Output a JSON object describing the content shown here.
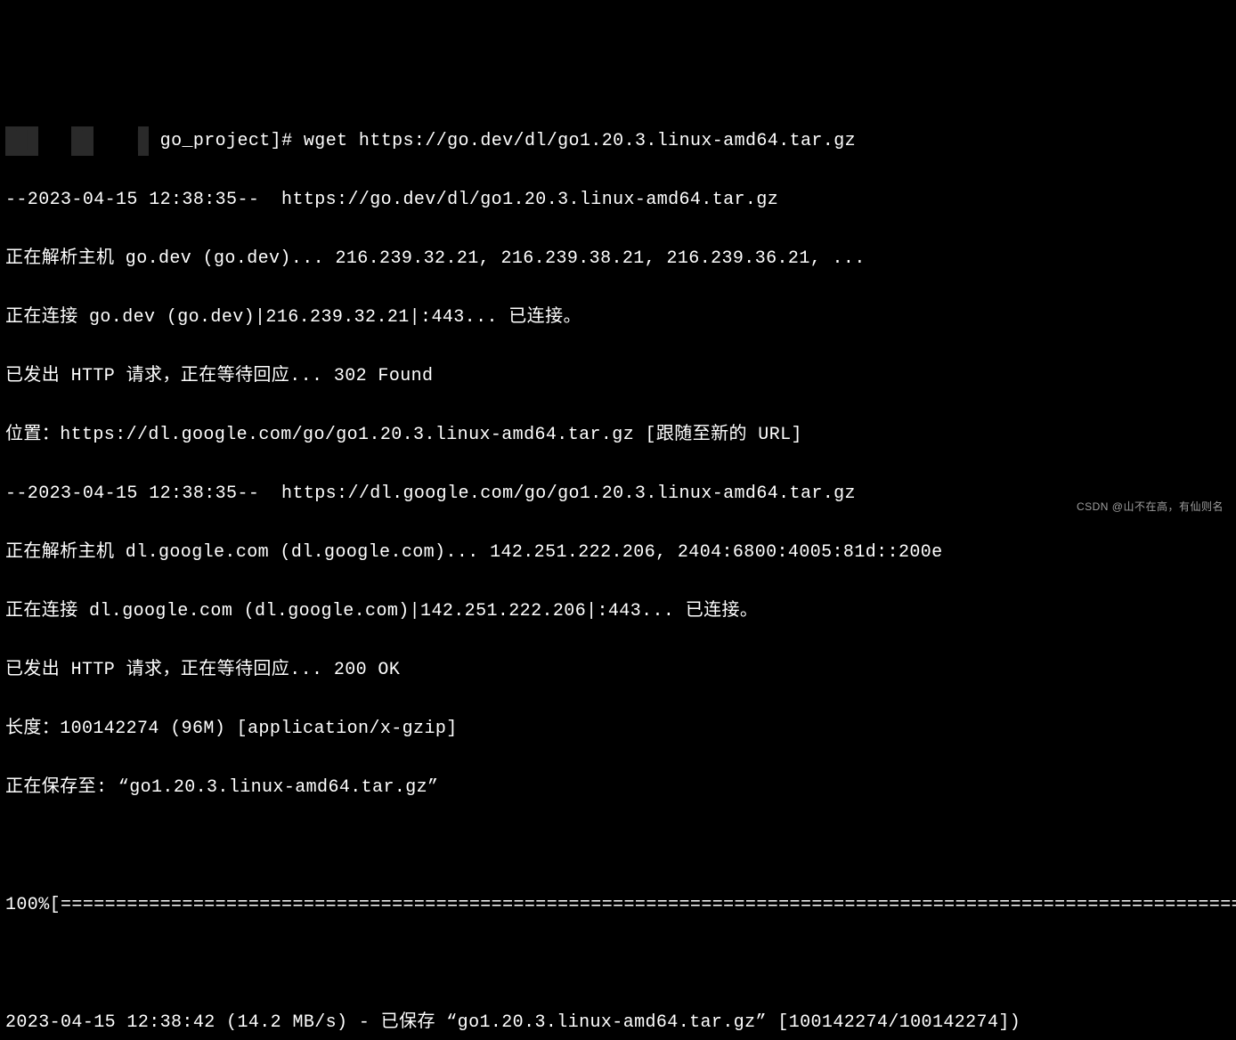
{
  "terminal": {
    "prompt_prefix_redacted1": "███",
    "prompt_prefix_redacted2": "██",
    "prompt_prefix_redacted3": "█",
    "prompt_dir": " go_project]# ",
    "command": "wget https://go.dev/dl/go1.20.3.linux-amd64.tar.gz",
    "lines": [
      "--2023-04-15 12:38:35--  https://go.dev/dl/go1.20.3.linux-amd64.tar.gz",
      "正在解析主机 go.dev (go.dev)... 216.239.32.21, 216.239.38.21, 216.239.36.21, ...",
      "正在连接 go.dev (go.dev)|216.239.32.21|:443... 已连接。",
      "已发出 HTTP 请求，正在等待回应... 302 Found",
      "位置：https://dl.google.com/go/go1.20.3.linux-amd64.tar.gz [跟随至新的 URL]",
      "--2023-04-15 12:38:35--  https://dl.google.com/go/go1.20.3.linux-amd64.tar.gz",
      "正在解析主机 dl.google.com (dl.google.com)... 142.251.222.206, 2404:6800:4005:81d::200e",
      "正在连接 dl.google.com (dl.google.com)|142.251.222.206|:443... 已连接。",
      "已发出 HTTP 请求，正在等待回应... 200 OK",
      "长度：100142274 (96M) [application/x-gzip]",
      "正在保存至: “go1.20.3.linux-amd64.tar.gz”"
    ],
    "progress": "100%[===================================================================================================================",
    "final": "2023-04-15 12:38:42 (14.2 MB/s) - 已保存 “go1.20.3.linux-amd64.tar.gz” [100142274/100142274])"
  },
  "watermark": "CSDN @山不在高，有仙则名"
}
